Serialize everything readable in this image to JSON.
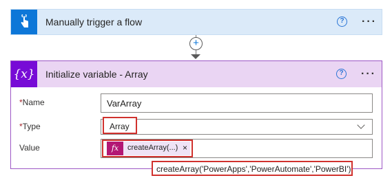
{
  "trigger": {
    "title": "Manually trigger a flow",
    "icon": "touch-icon",
    "help_label": "?",
    "more_label": "···"
  },
  "connector": {
    "plus_label": "+"
  },
  "action": {
    "title": "Initialize variable - Array",
    "icon_label": "{x}",
    "help_label": "?",
    "more_label": "···",
    "accent_color": "#770bd6",
    "fields": {
      "name_label": "Name",
      "name_value": "VarArray",
      "type_label": "Type",
      "type_value": "Array",
      "value_label": "Value",
      "required_marker": "*"
    },
    "token": {
      "fx_label": "fx",
      "text": "createArray(...)",
      "close_label": "×"
    }
  },
  "tooltip": {
    "text": "createArray('PowerApps','PowerAutomate','PowerBI')"
  }
}
